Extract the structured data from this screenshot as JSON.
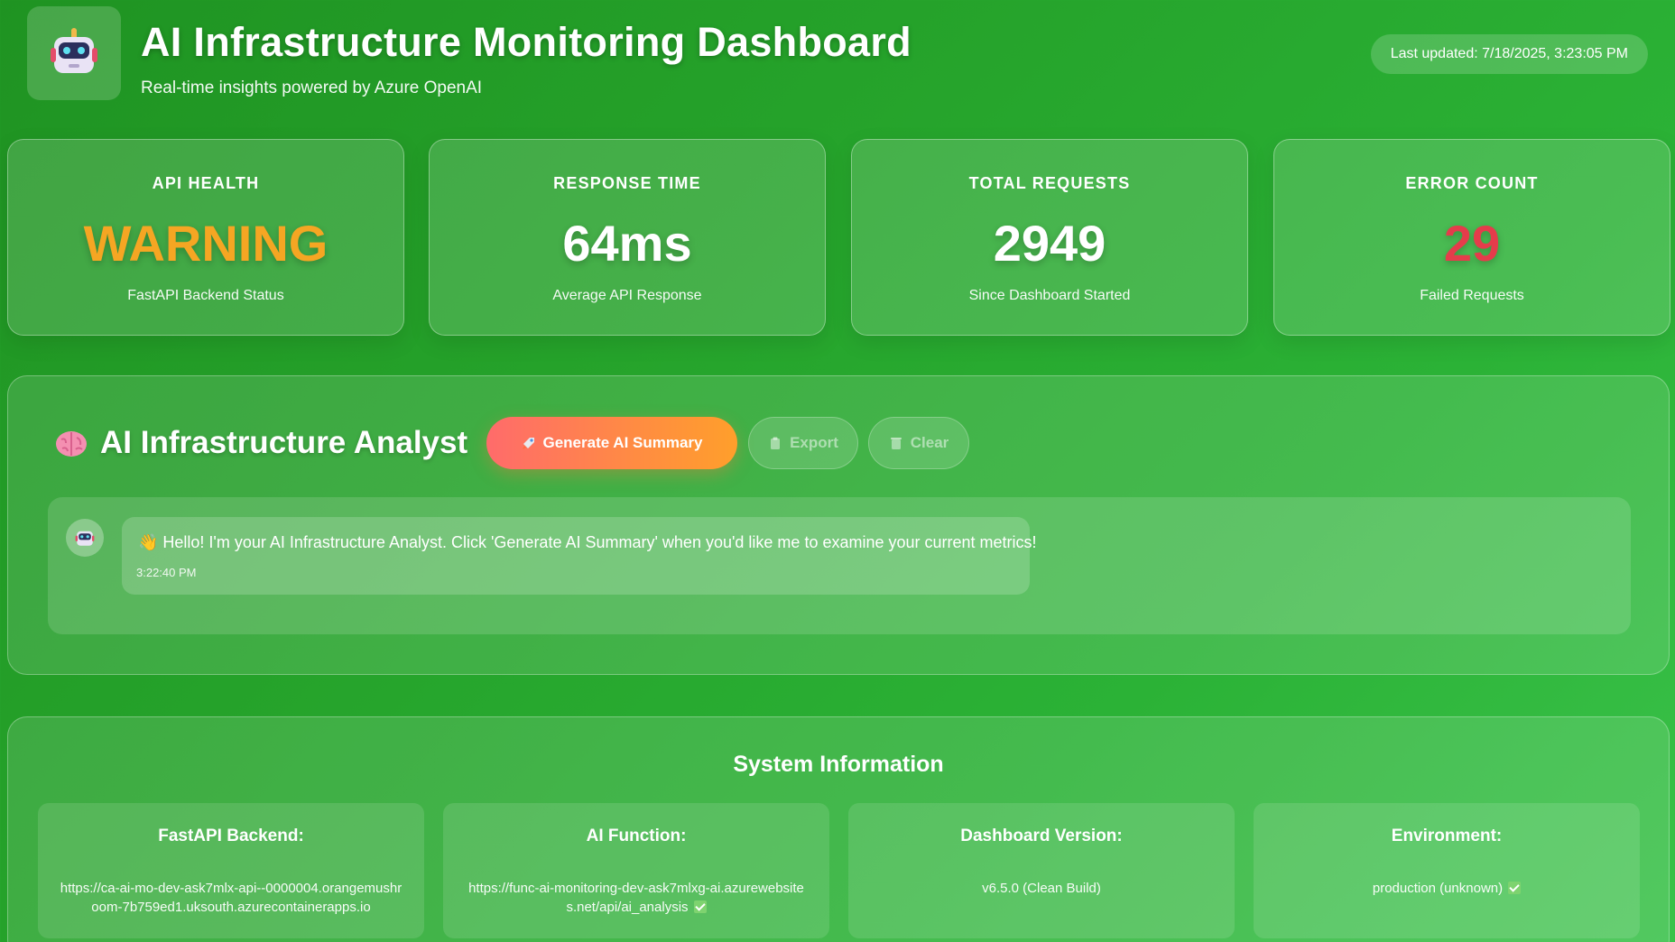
{
  "header": {
    "title": "AI Infrastructure Monitoring Dashboard",
    "subtitle": "Real-time insights powered by Azure OpenAI",
    "last_updated": "Last updated: 7/18/2025, 3:23:05 PM",
    "logo_icon": "robot-icon"
  },
  "metrics": [
    {
      "label": "API HEALTH",
      "value": "WARNING",
      "sub": "FastAPI Backend Status",
      "color": "#f5a623"
    },
    {
      "label": "RESPONSE TIME",
      "value": "64ms",
      "sub": "Average API Response",
      "color": "#ffffff"
    },
    {
      "label": "TOTAL REQUESTS",
      "value": "2949",
      "sub": "Since Dashboard Started",
      "color": "#ffffff"
    },
    {
      "label": "ERROR COUNT",
      "value": "29",
      "sub": "Failed Requests",
      "color": "#e53c4b"
    }
  ],
  "analyst": {
    "title": "AI Infrastructure Analyst",
    "icon": "brain-icon",
    "buttons": {
      "generate": "Generate AI Summary",
      "export": "Export",
      "clear": "Clear"
    },
    "messages": [
      {
        "avatar_icon": "robot-icon",
        "text": "👋 Hello! I'm your AI Infrastructure Analyst. Click 'Generate AI Summary' when you'd like me to examine your current metrics!",
        "time": "3:22:40 PM"
      }
    ]
  },
  "system_info": {
    "title": "System Information",
    "items": [
      {
        "label": "FastAPI Backend:",
        "value": "https://ca-ai-mo-dev-ask7mlx-api--0000004.orangemushroom-7b759ed1.uksouth.azurecontainerapps.io",
        "checked": false
      },
      {
        "label": "AI Function:",
        "value": "https://func-ai-monitoring-dev-ask7mlxg-ai.azurewebsites.net/api/ai_analysis",
        "checked": true
      },
      {
        "label": "Dashboard Version:",
        "value": "v6.5.0 (Clean Build)",
        "checked": false
      },
      {
        "label": "Environment:",
        "value": "production (unknown)",
        "checked": true
      }
    ]
  },
  "colors": {
    "background_start": "#1f9322",
    "background_end": "#3ac24a",
    "warning": "#f5a623",
    "error": "#e53c4b",
    "generate_button_start": "#ff6b6b",
    "generate_button_end": "#ff9f2b"
  }
}
